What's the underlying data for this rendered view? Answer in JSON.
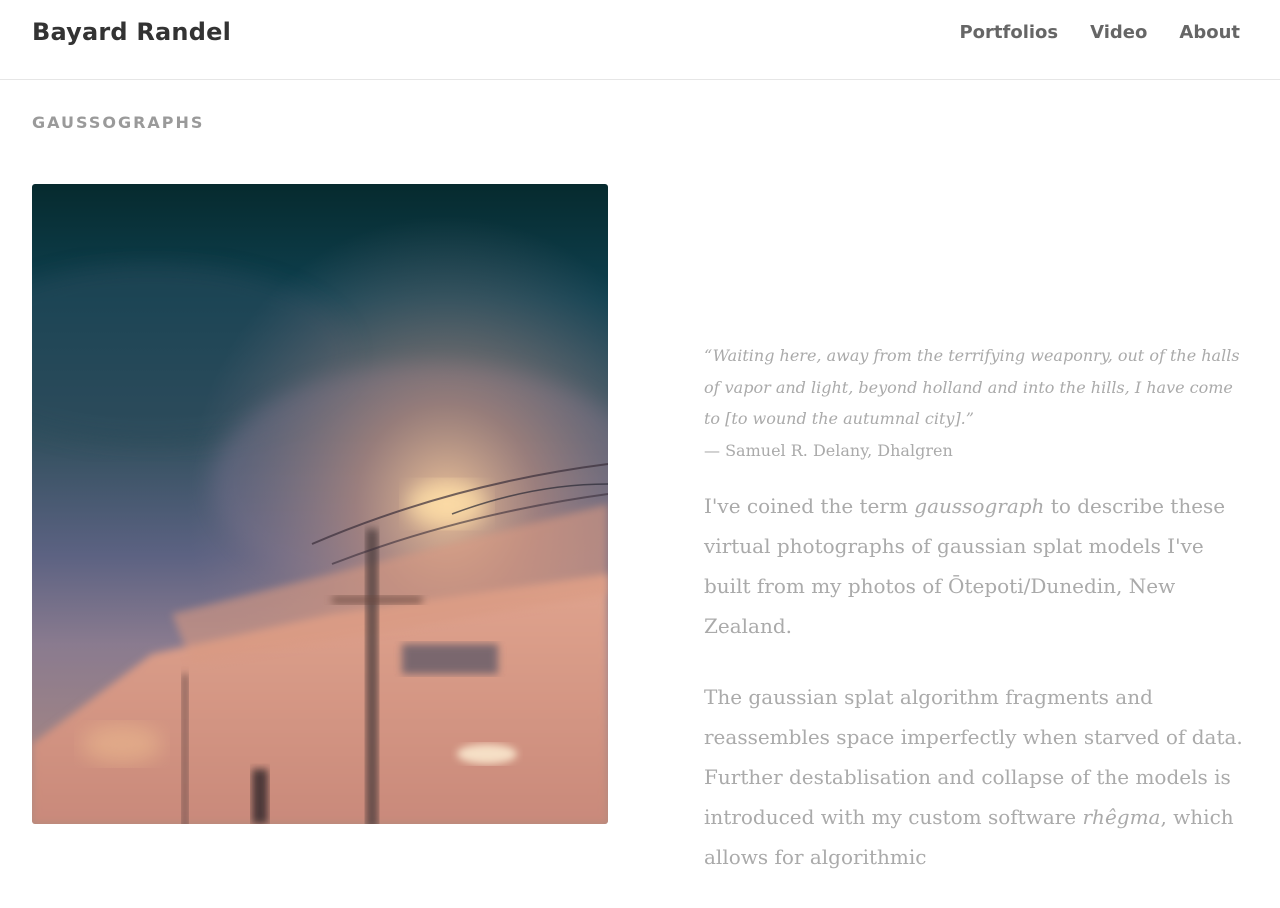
{
  "header": {
    "site_title": "Bayard Randel",
    "nav": [
      {
        "label": "Portfolios"
      },
      {
        "label": "Video"
      },
      {
        "label": "About"
      }
    ]
  },
  "section": {
    "label": "GAUSSOGRAPHS"
  },
  "photo": {
    "description_icon": "gaussograph-photo"
  },
  "quote": {
    "text": "“Waiting here, away from the terrifying weaponry, out of the halls of vapor and light, beyond holland and into the hills, I have come to [to wound the autumnal city].”",
    "attribution": "— Samuel R. Delany, Dhalgren"
  },
  "paragraphs": {
    "p1_before": "I've coined the term ",
    "p1_term": "gaussograph",
    "p1_after": " to describe these virtual photographs of gaussian splat models I've built from my photos of Ōtepoti/Dunedin, New Zealand.",
    "p2_before": "The gaussian splat algorithm fragments and reassembles space imperfectly when starved of data. Further destablisation and collapse of the models is introduced with my custom software ",
    "p2_term": "rhêgma",
    "p2_after": ", which allows for algorithmic"
  },
  "colors": {
    "title": "#333333",
    "nav": "#666666",
    "muted_text": "#aaaaaa",
    "divider": "#e6e6e6"
  }
}
